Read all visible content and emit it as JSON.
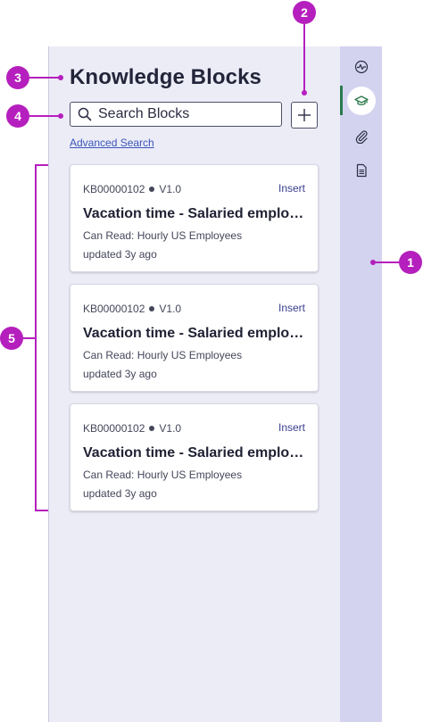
{
  "panel": {
    "title": "Knowledge Blocks",
    "search": {
      "placeholder": "Search Blocks",
      "value": ""
    },
    "add_button_symbol": "+",
    "advanced_search": "Advanced Search"
  },
  "cards": [
    {
      "id": "KB00000102",
      "version": "V1.0",
      "action": "Insert",
      "title": "Vacation time - Salaried employe...",
      "permission": "Can Read: Hourly US Employees",
      "updated": "updated 3y ago"
    },
    {
      "id": "KB00000102",
      "version": "V1.0",
      "action": "Insert",
      "title": "Vacation time - Salaried employe...",
      "permission": "Can Read: Hourly US Employees",
      "updated": "updated 3y ago"
    },
    {
      "id": "KB00000102",
      "version": "V1.0",
      "action": "Insert",
      "title": "Vacation time - Salaried employe...",
      "permission": "Can Read: Hourly US Employees",
      "updated": "updated 3y ago"
    }
  ],
  "rail": {
    "items": [
      {
        "icon": "activity-icon"
      },
      {
        "icon": "graduation-cap-icon",
        "active": true
      },
      {
        "icon": "paperclip-icon"
      },
      {
        "icon": "document-icon"
      }
    ]
  },
  "callouts": [
    "1",
    "2",
    "3",
    "4",
    "5"
  ],
  "colors": {
    "accent": "#b51fbd",
    "panel_bg": "#ececf7",
    "rail_bg": "#d3d3f0",
    "active_indicator": "#2b7a4b",
    "link": "#3a55b8"
  }
}
